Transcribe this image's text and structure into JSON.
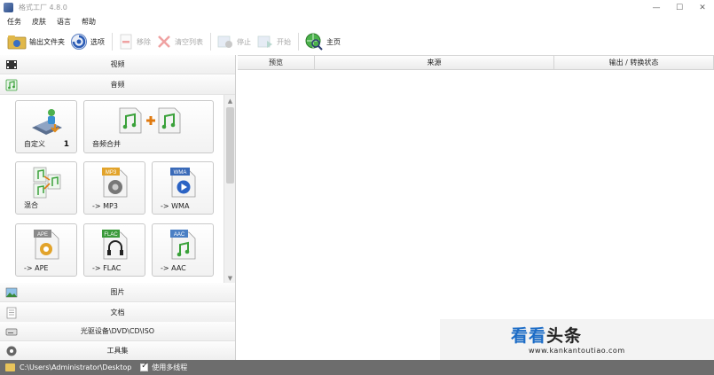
{
  "window": {
    "title": "格式工厂 4.8.0",
    "min": "—",
    "max": "☐",
    "close": "✕"
  },
  "menu": [
    "任务",
    "皮肤",
    "语言",
    "帮助"
  ],
  "toolbar": {
    "output_folder": "输出文件夹",
    "options": "选项",
    "remove": "移除",
    "clear_list": "清空列表",
    "stop": "停止",
    "start": "开始",
    "home": "主页"
  },
  "categories": {
    "video": "视频",
    "audio": "音频",
    "image": "图片",
    "document": "文档",
    "disc": "光驱设备\\DVD\\CD\\ISO",
    "tools": "工具集"
  },
  "tiles": {
    "custom": {
      "label": "自定义",
      "count": "1"
    },
    "merge": {
      "label": "音频合并"
    },
    "mix": {
      "label": "混合"
    },
    "mp3": {
      "label": "-> MP3",
      "badge": "MP3"
    },
    "wma": {
      "label": "-> WMA",
      "badge": "WMA"
    },
    "ape": {
      "label": "-> APE",
      "badge": "APE"
    },
    "flac": {
      "label": "-> FLAC",
      "badge": "FLAC"
    },
    "aac": {
      "label": "-> AAC",
      "badge": "AAC"
    }
  },
  "table": {
    "columns": [
      "预览",
      "来源",
      "输出 / 转换状态"
    ]
  },
  "watermark": {
    "a": "看看",
    "b": "头条",
    "url": "www.kankantoutiao.com"
  },
  "status": {
    "path": "C:\\Users\\Administrator\\Desktop",
    "multithread": "使用多线程"
  },
  "colors": {
    "accent": "#1c6cc6",
    "statusbar": "#6d6d6d",
    "music_green": "#3aa13a"
  }
}
